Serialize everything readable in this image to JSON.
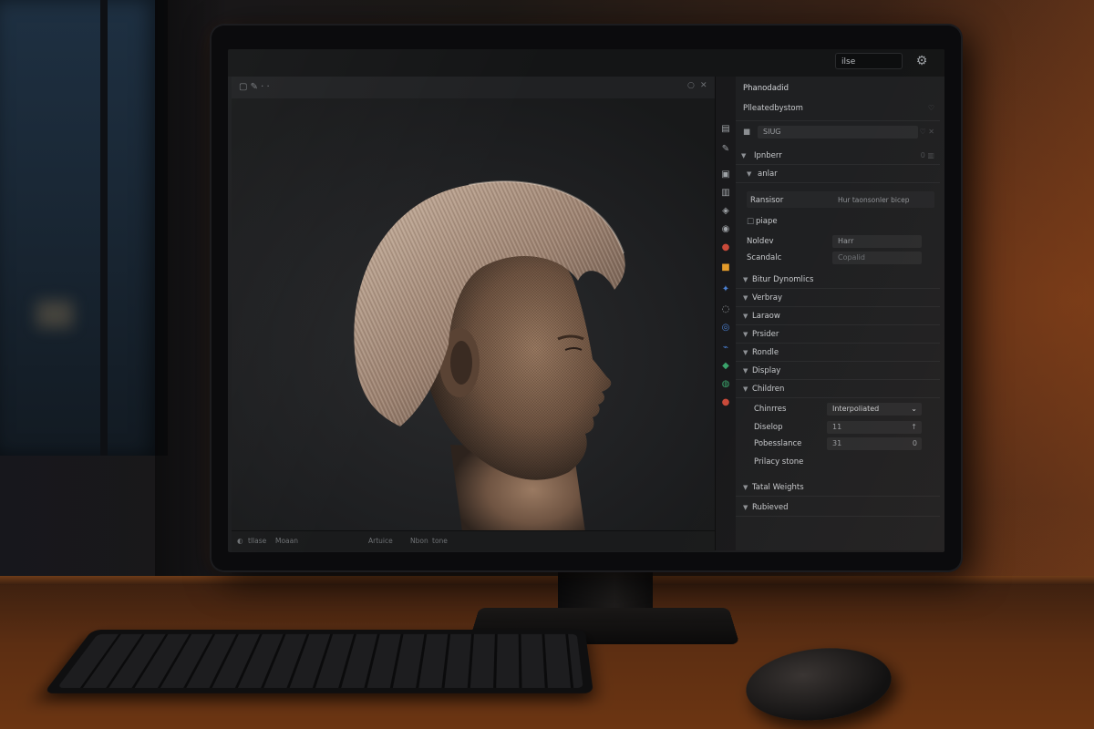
{
  "topbar": {
    "search_value": "ilse"
  },
  "panel": {
    "header": "Phanodadid",
    "object_path": "Plleatedbystom",
    "object_field_placeholder": "SIUG",
    "group_title": "Ipnberr",
    "subgroup": "anlar",
    "fields": [
      {
        "label": "Ransisor",
        "value": "Hur taonsonler bicep"
      },
      {
        "label": "piape"
      },
      {
        "label": "Noldev",
        "value": "Harr"
      },
      {
        "label": "Scandalc",
        "value": "Copalid"
      }
    ],
    "sections": [
      {
        "label": "Bitur Dynomlics"
      },
      {
        "label": "Verbray"
      },
      {
        "label": "Laraow"
      },
      {
        "label": "Prsider"
      },
      {
        "label": "Rondle"
      },
      {
        "label": "Display"
      },
      {
        "label": "Children"
      }
    ],
    "children": {
      "rows": [
        {
          "label": "Chinrres",
          "value": "Interpoliated"
        },
        {
          "label": "Diselop",
          "value": "11"
        },
        {
          "label": "Pobesslance",
          "value": "31",
          "value2": "0"
        },
        {
          "label": "Prilacy stone"
        }
      ]
    },
    "footer_sections": [
      {
        "label": "Tatal Weights"
      },
      {
        "label": "Rubieved"
      }
    ]
  },
  "viewport": {
    "footer": {
      "item1": "tllase",
      "item2": "Moaan",
      "item3": "Artuice",
      "item4": "Nbon",
      "item5": "tone"
    }
  },
  "icons": [
    "gear-icon",
    "search-icon",
    "wrench-icon",
    "object-icon",
    "modifier-icon",
    "particle-icon",
    "physics-icon",
    "constraint-icon",
    "data-icon",
    "material-icon",
    "texture-icon",
    "world-icon",
    "render-icon"
  ],
  "colors": {
    "panel_bg": "#1f2022",
    "accent_orange": "#e39b2a",
    "accent_red": "#c94a3a",
    "accent_green": "#3aa36b",
    "accent_blue": "#4a7fd1"
  }
}
